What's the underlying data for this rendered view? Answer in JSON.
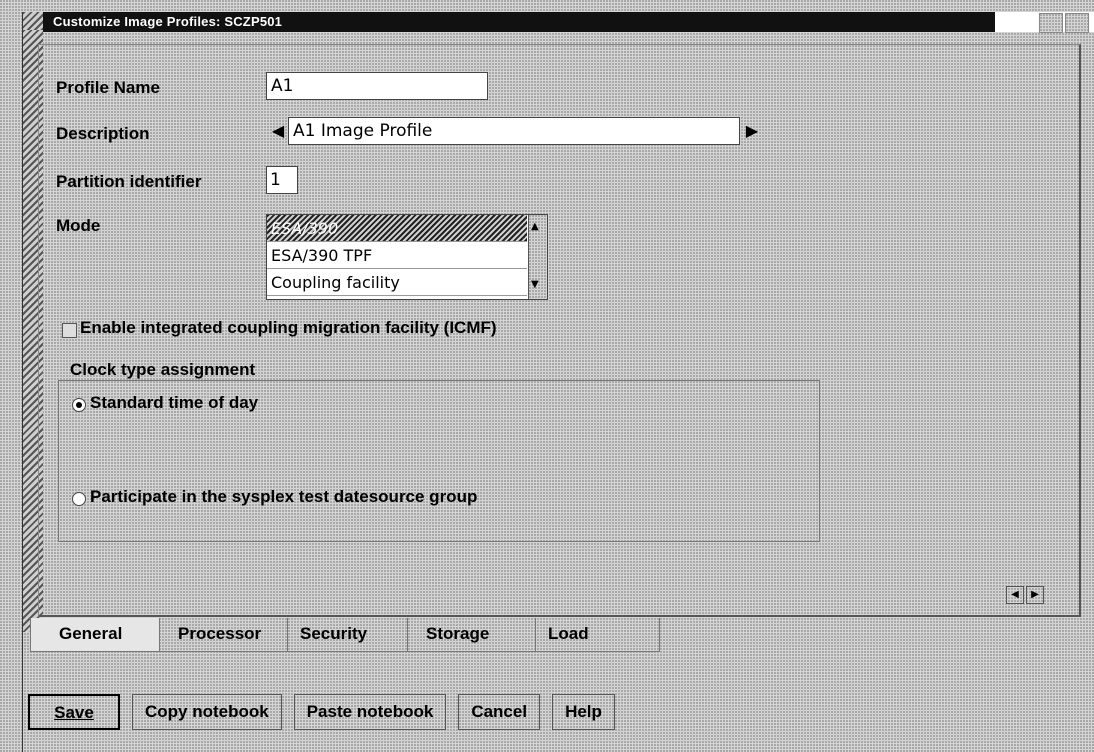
{
  "window": {
    "title": "Customize Image Profiles: SCZP501"
  },
  "form": {
    "profile_name_label": "Profile Name",
    "profile_name_value": "A1",
    "description_label": "Description",
    "description_value": "A1 Image Profile",
    "partition_label": "Partition identifier",
    "partition_value": "1",
    "mode_label": "Mode",
    "mode_options": [
      "ESA/390",
      "ESA/390 TPF",
      "Coupling facility"
    ],
    "mode_selected": "ESA/390",
    "icmf_label": "Enable integrated coupling migration facility (ICMF)",
    "icmf_checked": false
  },
  "clock": {
    "group_label": "Clock type assignment",
    "standard_label": "Standard time of day",
    "standard_selected": true,
    "sysplex_label": "Participate in the sysplex test datesource group",
    "sysplex_selected": false
  },
  "tabs": [
    "General",
    "Processor",
    "Security",
    "Storage",
    "Load"
  ],
  "active_tab": "General",
  "buttons": {
    "save": "Save",
    "copy": "Copy notebook",
    "paste": "Paste notebook",
    "cancel": "Cancel",
    "help": "Help"
  },
  "icons": {
    "left_arrow": "◀",
    "right_arrow": "▶",
    "up_arrow": "▲",
    "down_arrow": "▼"
  }
}
